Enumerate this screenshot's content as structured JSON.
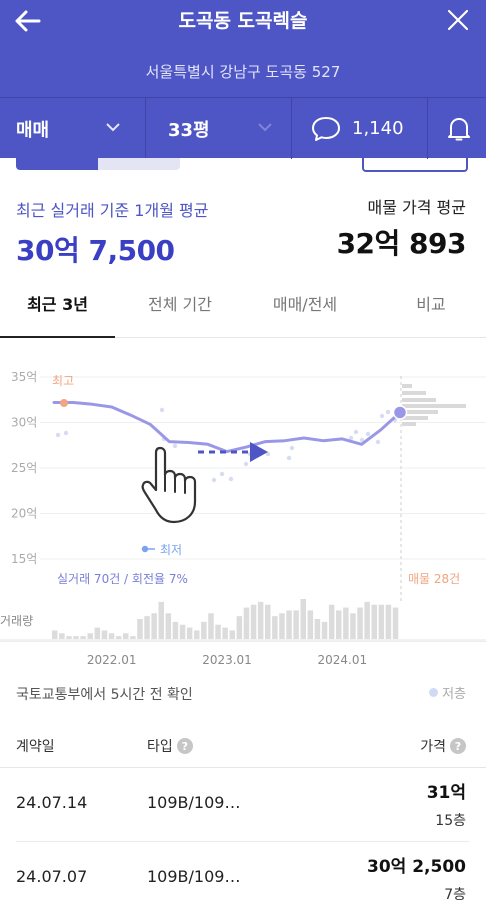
{
  "header": {
    "title": "도곡동 도곡렉슬",
    "address": "서울특별시 강남구 도곡동 527"
  },
  "filters": {
    "deal_type": "매매",
    "size": "33평",
    "comment_count": "1,140"
  },
  "summary": {
    "recent_label": "최근 실거래 기준 1개월 평균",
    "recent_value": "30억 7,500",
    "listing_label": "매물 가격 평균",
    "listing_value": "32억 893"
  },
  "tabs": [
    {
      "label": "최근 3년",
      "active": true
    },
    {
      "label": "전체 기간",
      "active": false
    },
    {
      "label": "매매/전세",
      "active": false
    },
    {
      "label": "비교",
      "active": false
    }
  ],
  "chart_data": {
    "type": "line",
    "y_ticks": [
      "35억",
      "30억",
      "25억",
      "20억",
      "15억"
    ],
    "x_ticks": [
      "2022.01",
      "2023.01",
      "2024.01"
    ],
    "ylim": [
      15,
      35
    ],
    "series": [
      {
        "name": "",
        "color": "#9a98e6",
        "x": [
          "2021.07",
          "2021.09",
          "2021.11",
          "2022.01",
          "2022.03",
          "2022.05",
          "2022.07",
          "2022.09",
          "2022.11",
          "2023.01",
          "2023.03",
          "2023.05",
          "2023.07",
          "2023.09",
          "2023.11",
          "2024.01",
          "2024.03",
          "2024.05",
          "2024.07"
        ],
        "values": [
          32.2,
          32.2,
          32.0,
          31.7,
          30.8,
          29.8,
          27.9,
          27.8,
          27.6,
          26.8,
          27.3,
          27.9,
          28.0,
          28.3,
          28.0,
          28.2,
          27.6,
          29.2,
          31.1
        ]
      }
    ],
    "max_label": "최고",
    "min_label": "최저",
    "deal_note": "실거래 70건 / 회전율 7%",
    "listing_note": "매물 28건",
    "volume_label": "거래량",
    "volume": [
      3,
      2,
      1,
      1,
      1,
      2,
      4,
      3,
      2,
      1,
      2,
      1,
      7,
      8,
      9,
      13,
      9,
      6,
      5,
      4,
      3,
      6,
      9,
      5,
      4,
      3,
      8,
      11,
      12,
      13,
      12,
      8,
      9,
      10,
      10,
      14,
      10,
      7,
      6,
      12,
      10,
      11,
      9,
      11,
      13,
      12,
      12,
      12,
      11
    ]
  },
  "hint_icon": "hand-pointer-icon",
  "source_note": "국토교통부에서 5시간 전 확인",
  "low_legend": "저층",
  "table": {
    "headers": {
      "date": "계약일",
      "type": "타입",
      "price": "가격"
    },
    "rows": [
      {
        "date": "24.07.14",
        "type": "109B/109…",
        "price": "31억",
        "floor": "15층"
      },
      {
        "date": "24.07.07",
        "type": "109B/109…",
        "price": "30억 2,500",
        "floor": "7층"
      }
    ]
  },
  "colors": {
    "brand": "#4e55c4",
    "line": "#9a98e6",
    "accent_orange": "#f2a580",
    "low_blue": "#7ba2f0"
  }
}
